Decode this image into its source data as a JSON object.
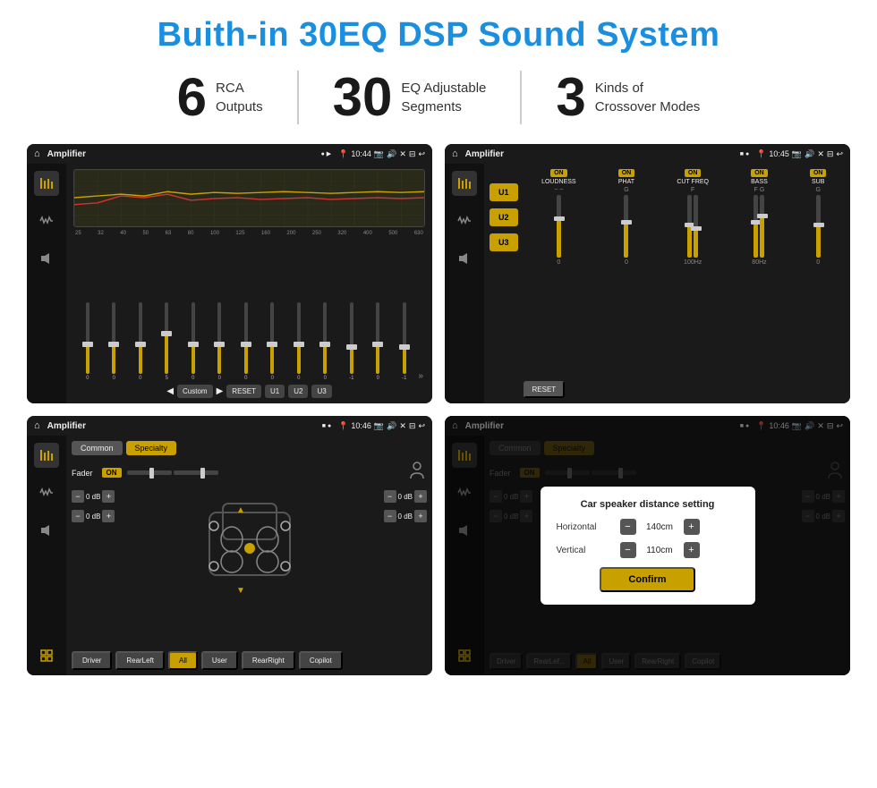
{
  "page": {
    "title": "Buith-in 30EQ DSP Sound System",
    "stats": [
      {
        "number": "6",
        "label_line1": "RCA",
        "label_line2": "Outputs"
      },
      {
        "number": "30",
        "label_line1": "EQ Adjustable",
        "label_line2": "Segments"
      },
      {
        "number": "3",
        "label_line1": "Kinds of",
        "label_line2": "Crossover Modes"
      }
    ]
  },
  "screens": {
    "eq": {
      "app_title": "Amplifier",
      "time": "10:44",
      "freq_labels": [
        "25",
        "32",
        "40",
        "50",
        "63",
        "80",
        "100",
        "125",
        "160",
        "200",
        "250",
        "320",
        "400",
        "500",
        "630"
      ],
      "slider_values": [
        "0",
        "0",
        "0",
        "5",
        "0",
        "0",
        "0",
        "0",
        "0",
        "0",
        "-1",
        "0",
        "-1"
      ],
      "buttons": [
        "Custom",
        "RESET",
        "U1",
        "U2",
        "U3"
      ]
    },
    "crossover": {
      "app_title": "Amplifier",
      "time": "10:45",
      "presets": [
        "U1",
        "U2",
        "U3"
      ],
      "channels": [
        "LOUDNESS",
        "PHAT",
        "CUT FREQ",
        "BASS",
        "SUB"
      ],
      "on_label": "ON",
      "reset_label": "RESET"
    },
    "fader": {
      "app_title": "Amplifier",
      "time": "10:46",
      "tabs": [
        "Common",
        "Specialty"
      ],
      "fader_label": "Fader",
      "on_label": "ON",
      "db_values": [
        "0 dB",
        "0 dB",
        "0 dB",
        "0 dB"
      ],
      "bottom_buttons": [
        "Driver",
        "RearLeft",
        "All",
        "User",
        "RearRight",
        "Copilot"
      ]
    },
    "distance": {
      "app_title": "Amplifier",
      "time": "10:46",
      "tabs": [
        "Common",
        "Specialty"
      ],
      "dialog_title": "Car speaker distance setting",
      "horizontal_label": "Horizontal",
      "horizontal_value": "140cm",
      "vertical_label": "Vertical",
      "vertical_value": "110cm",
      "confirm_label": "Confirm",
      "db_values": [
        "0 dB",
        "0 dB"
      ],
      "bottom_buttons": [
        "Driver",
        "RearLef...",
        "All",
        "User",
        "RearRight",
        "Copilot"
      ]
    }
  },
  "icons": {
    "home": "⌂",
    "back": "↩",
    "location": "📍",
    "camera": "📷",
    "volume": "🔊",
    "close": "✕",
    "window": "⊟",
    "eq_icon": "≡",
    "wave_icon": "〜",
    "speaker_icon": "▦",
    "expand_icon": "⊕",
    "forward": "▶",
    "backward": "◀",
    "up": "▲",
    "down": "▼"
  },
  "colors": {
    "accent": "#c8a000",
    "bg_dark": "#1a1a1a",
    "bg_darker": "#111111",
    "text_light": "#eeeeee",
    "title_blue": "#1a8fe0"
  }
}
